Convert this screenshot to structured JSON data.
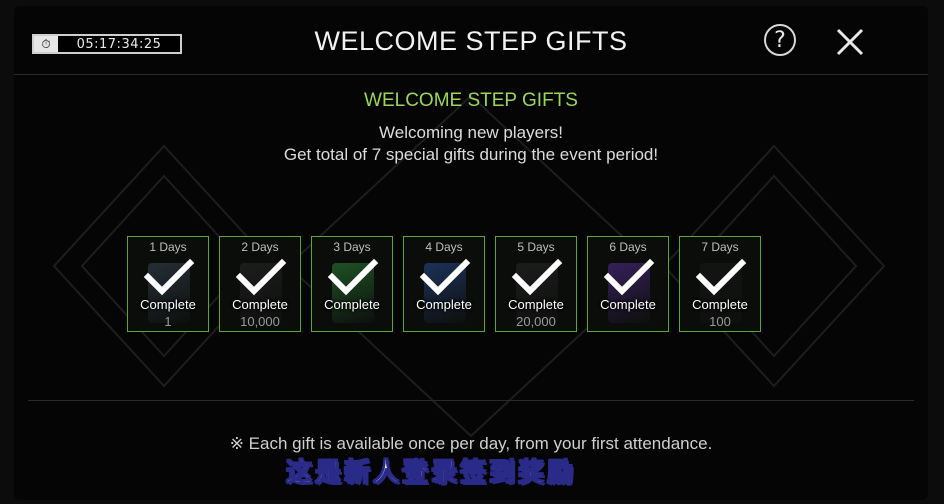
{
  "header": {
    "timer": "05:17:34:25",
    "title": "WELCOME STEP GIFTS",
    "help_label": "?"
  },
  "main": {
    "subtitle": "WELCOME STEP GIFTS",
    "desc_line1": "Welcoming new players!",
    "desc_line2": "Get total of 7 special gifts during the event period!",
    "days": [
      {
        "label": "1 Days",
        "status": "Complete",
        "amount": "1",
        "reward_color": "#3a4a5a"
      },
      {
        "label": "2 Days",
        "status": "Complete",
        "amount": "10,000",
        "reward_color": "#2a2a2a"
      },
      {
        "label": "3 Days",
        "status": "Complete",
        "amount": "",
        "reward_color": "#2e8a3a"
      },
      {
        "label": "4 Days",
        "status": "Complete",
        "amount": "",
        "reward_color": "#2a4f9a"
      },
      {
        "label": "5 Days",
        "status": "Complete",
        "amount": "20,000",
        "reward_color": "#2a2a2a"
      },
      {
        "label": "6 Days",
        "status": "Complete",
        "amount": "",
        "reward_color": "#5a2f9a"
      },
      {
        "label": "7 Days",
        "status": "Complete",
        "amount": "100",
        "reward_color": "#1a1a1a"
      }
    ],
    "note": "※ Each gift is available once per day, from your first attendance."
  },
  "caption": "这是新人登录签到奖励",
  "colors": {
    "accent_green": "#9ad65a",
    "card_border": "#5aa832"
  }
}
